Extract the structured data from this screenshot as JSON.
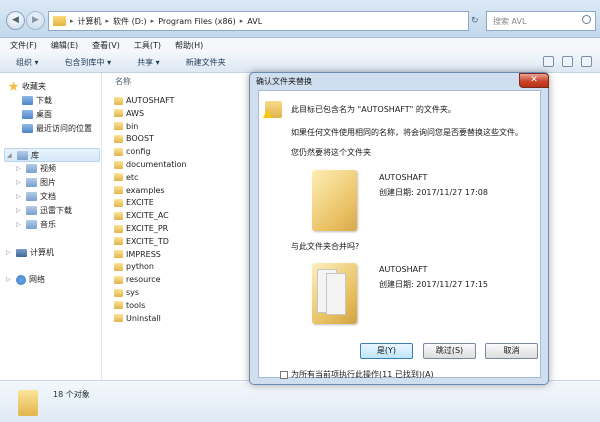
{
  "explorer": {
    "breadcrumbs": [
      "计算机",
      "软件 (D:)",
      "Program Files (x86)",
      "AVL"
    ],
    "search_placeholder": "搜索 AVL",
    "menu": [
      "文件(F)",
      "编辑(E)",
      "查看(V)",
      "工具(T)",
      "帮助(H)"
    ],
    "toolbar": [
      "组织 ▾",
      "包含到库中 ▾",
      "共享 ▾",
      "新建文件夹"
    ],
    "sidebar": {
      "favorites": "收藏夹",
      "fav_items": [
        "下载",
        "桌面",
        "最近访问的位置"
      ],
      "libraries": "库",
      "lib_items": [
        "视频",
        "图片",
        "文档",
        "迅雷下载",
        "音乐"
      ],
      "computer": "计算机",
      "network": "网络"
    },
    "column_header": "名称",
    "files": [
      "AUTOSHAFT",
      "AWS",
      "bin",
      "BOOST",
      "config",
      "documentation",
      "etc",
      "examples",
      "EXCITE",
      "EXCITE_AC",
      "EXCITE_PR",
      "EXCITE_TD",
      "IMPRESS",
      "python",
      "resource",
      "sys",
      "tools",
      "Uninstall"
    ],
    "status": "18 个对象"
  },
  "dialog": {
    "title": "确认文件夹替换",
    "close": "✕",
    "message": "此目标已包含名为 \"AUTOSHAFT\" 的文件夹。",
    "detail": "如果任何文件使用相同的名称，将会询问您是否要替换这些文件。",
    "question_replace": "您仍然要将这个文件夹",
    "existing": {
      "name": "AUTOSHAFT",
      "date": "创建日期: 2017/11/27 17:08"
    },
    "question_merge": "与此文件夹合并吗?",
    "incoming": {
      "name": "AUTOSHAFT",
      "date": "创建日期: 2017/11/27 17:15"
    },
    "buttons": {
      "yes": "是(Y)",
      "skip": "跳过(S)",
      "cancel": "取消"
    },
    "checkbox": "为所有当前项执行此操作(11 已找到)(A)"
  }
}
